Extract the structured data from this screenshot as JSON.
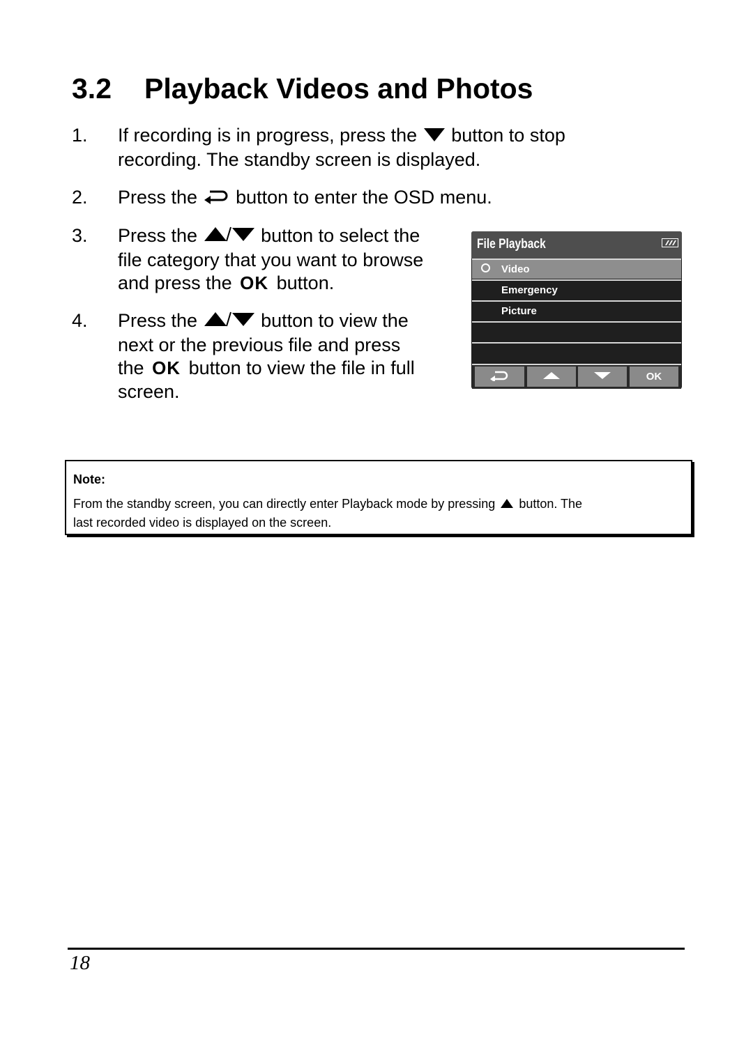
{
  "section": {
    "number": "3.2",
    "title": "Playback Videos and Photos"
  },
  "steps": [
    {
      "number": "1.",
      "line1_pre": "If recording is in progress, press the",
      "line1_icon": "down-triangle-icon",
      "line1_post": "button to stop",
      "line2": "recording. The standby screen is displayed."
    },
    {
      "number": "2.",
      "line1_pre": "Press the",
      "line1_icon": "return-arrow-icon",
      "line1_post": "button to enter the OSD menu."
    },
    {
      "number": "3.",
      "line1_pre": "Press the",
      "line1_icon": "up-down-triangle-icon",
      "line1_post": "button to select the",
      "line2": "file category that you want to browse",
      "line3_pre": "and press the",
      "line3_ok": "OK",
      "line3_post": "button."
    },
    {
      "number": "4.",
      "line1_pre": "Press the",
      "line1_icon": "up-down-triangle-icon",
      "line1_post": "button to view the",
      "line2": "next or the previous file and press",
      "line3_pre": "the",
      "line3_ok": "OK",
      "line3_post": "button to view the file in full",
      "line4": "screen."
    }
  ],
  "osd": {
    "title": "File Playback",
    "battery_icon": "battery-icon",
    "items": [
      {
        "label": "Video",
        "selected": true
      },
      {
        "label": "Emergency",
        "selected": false
      },
      {
        "label": "Picture",
        "selected": false
      },
      {
        "label": "",
        "selected": false
      },
      {
        "label": "",
        "selected": false
      }
    ],
    "buttons": [
      {
        "icon": "return-arrow-icon",
        "label": ""
      },
      {
        "icon": "up-triangle-icon",
        "label": ""
      },
      {
        "icon": "down-triangle-icon",
        "label": ""
      },
      {
        "icon": "",
        "label": "OK"
      }
    ]
  },
  "note": {
    "heading": "Note:",
    "text_pre": "From the standby screen, you can directly enter Playback mode by pressing",
    "text_icon": "up-triangle-icon",
    "text_post": "button. The",
    "text_line2": "last recorded video is displayed on the screen."
  },
  "footer": {
    "page_number": "18"
  }
}
